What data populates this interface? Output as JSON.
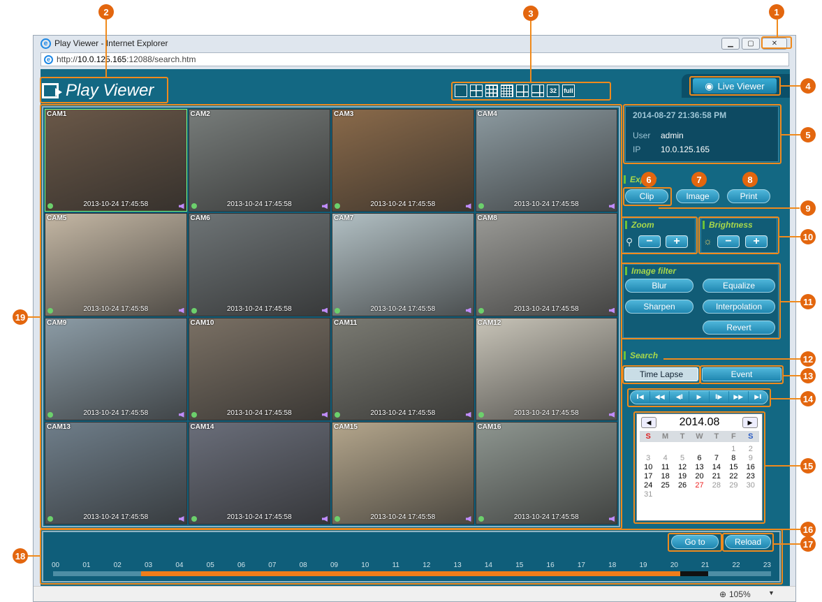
{
  "window": {
    "title": "Play Viewer - Internet Explorer",
    "url_prefix": "http://",
    "url_host": "10.0.125.165",
    "url_rest": ":12088/search.htm",
    "zoom": "105%"
  },
  "header": {
    "logo": "Play Viewer",
    "live_viewer": "Live Viewer",
    "layouts": [
      "",
      "",
      "",
      "",
      "",
      "",
      "32",
      "full"
    ]
  },
  "cameras": [
    {
      "label": "CAM1",
      "ts": "2013-10-24 17:45:58",
      "bg": "#6a5848"
    },
    {
      "label": "CAM2",
      "ts": "2013-10-24 17:45:58",
      "bg": "#777c7a"
    },
    {
      "label": "CAM3",
      "ts": "2013-10-24 17:45:58",
      "bg": "#8a6a4a"
    },
    {
      "label": "CAM4",
      "ts": "2013-10-24 17:45:58",
      "bg": "#8c9aa0"
    },
    {
      "label": "CAM5",
      "ts": "2013-10-24 17:45:58",
      "bg": "#c4b7a4"
    },
    {
      "label": "CAM6",
      "ts": "2013-10-24 17:45:58",
      "bg": "#6e7476"
    },
    {
      "label": "CAM7",
      "ts": "2013-10-24 17:45:58",
      "bg": "#b2c0c4"
    },
    {
      "label": "CAM8",
      "ts": "2013-10-24 17:45:58",
      "bg": "#9a9a96"
    },
    {
      "label": "CAM9",
      "ts": "2013-10-24 17:45:58",
      "bg": "#8c9ca6"
    },
    {
      "label": "CAM10",
      "ts": "2013-10-24 17:45:58",
      "bg": "#7a7064"
    },
    {
      "label": "CAM11",
      "ts": "2013-10-24 17:45:58",
      "bg": "#7a7a72"
    },
    {
      "label": "CAM12",
      "ts": "2013-10-24 17:45:58",
      "bg": "#c8c4b8"
    },
    {
      "label": "CAM13",
      "ts": "2013-10-24 17:45:58",
      "bg": "#6f7e8a"
    },
    {
      "label": "CAM14",
      "ts": "2013-10-24 17:45:58",
      "bg": "#6a6e7a"
    },
    {
      "label": "CAM15",
      "ts": "2013-10-24 17:45:58",
      "bg": "#b4a68c"
    },
    {
      "label": "CAM16",
      "ts": "2013-10-24 17:45:58",
      "bg": "#8e9690"
    }
  ],
  "info": {
    "datetime": "2014-08-27 21:36:58 PM",
    "user_key": "User",
    "user_val": "admin",
    "ip_key": "IP",
    "ip_val": "10.0.125.165"
  },
  "export": {
    "title": "Export",
    "clip": "Clip",
    "image": "Image",
    "print": "Print"
  },
  "zoom": {
    "title": "Zoom",
    "minus": "−",
    "plus": "+"
  },
  "brightness": {
    "title": "Brightness",
    "minus": "−",
    "plus": "+"
  },
  "filter": {
    "title": "Image filter",
    "blur": "Blur",
    "equalize": "Equalize",
    "sharpen": "Sharpen",
    "interpolation": "Interpolation",
    "revert": "Revert"
  },
  "search": {
    "title": "Search",
    "timelapse": "Time Lapse",
    "event": "Event"
  },
  "playback": [
    "I◀",
    "◀◀",
    "◀I",
    "▶",
    "I▶",
    "▶▶",
    "▶I"
  ],
  "calendar": {
    "month": "2014.08",
    "dow": [
      "S",
      "M",
      "T",
      "W",
      "T",
      "F",
      "S"
    ],
    "days": [
      "",
      "",
      "",
      "",
      "",
      "1",
      "2",
      "3",
      "4",
      "5",
      "6",
      "7",
      "8",
      "9",
      "10",
      "11",
      "12",
      "13",
      "14",
      "15",
      "16",
      "17",
      "18",
      "19",
      "20",
      "21",
      "22",
      "23",
      "24",
      "25",
      "26",
      "27",
      "28",
      "29",
      "30",
      "31"
    ],
    "today": "27",
    "dark": [
      "6",
      "7",
      "8",
      "10",
      "11",
      "12",
      "13",
      "14",
      "15",
      "16",
      "17",
      "18",
      "19",
      "20",
      "21",
      "22",
      "23",
      "24",
      "25",
      "26"
    ]
  },
  "timeline": {
    "goto": "Go to",
    "reload": "Reload",
    "hours": [
      "00",
      "01",
      "02",
      "03",
      "04",
      "05",
      "06",
      "07",
      "08",
      "09",
      "10",
      "11",
      "12",
      "13",
      "14",
      "15",
      "16",
      "17",
      "18",
      "19",
      "20",
      "21",
      "22",
      "23"
    ]
  },
  "callouts": [
    "1",
    "2",
    "3",
    "4",
    "5",
    "6",
    "7",
    "8",
    "9",
    "10",
    "11",
    "12",
    "13",
    "14",
    "15",
    "16",
    "17",
    "18",
    "19"
  ],
  "colors": {
    "app_bg": "#136883",
    "accent": "#ef7d1a",
    "callout": "#e3660e"
  }
}
